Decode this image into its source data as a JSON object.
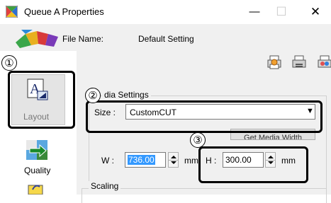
{
  "window": {
    "title": "Queue A Properties",
    "icon": "multicolor-window-icon",
    "controls": {
      "minimize": "—",
      "maximize": "☐",
      "close": "✕"
    }
  },
  "file": {
    "label": "File Name:",
    "value": "Default Setting"
  },
  "toolbar": {
    "icons": [
      "printer-settings-icon",
      "printer-queue-icon",
      "printer-color-icon"
    ]
  },
  "nav": {
    "items": [
      {
        "label": "Layout",
        "icon": "layout-icon",
        "selected": true
      },
      {
        "label": "Quality",
        "icon": "quality-icon",
        "selected": false
      }
    ]
  },
  "callouts": [
    "①",
    "②",
    "③"
  ],
  "media": {
    "legend": "dia Settings",
    "size_label": "Size :",
    "size_value": "CustomCUT",
    "get_media_width": "Get Media Width",
    "width_label": "W :",
    "width_value": "736.00",
    "width_unit": "mm",
    "height_label": "H :",
    "height_value": "300.00",
    "height_unit": "mm"
  },
  "scaling": {
    "legend": "Scaling"
  },
  "colors": {
    "selection": "#3399ff",
    "panel": "#f0f0f0",
    "callout": "#000000"
  }
}
